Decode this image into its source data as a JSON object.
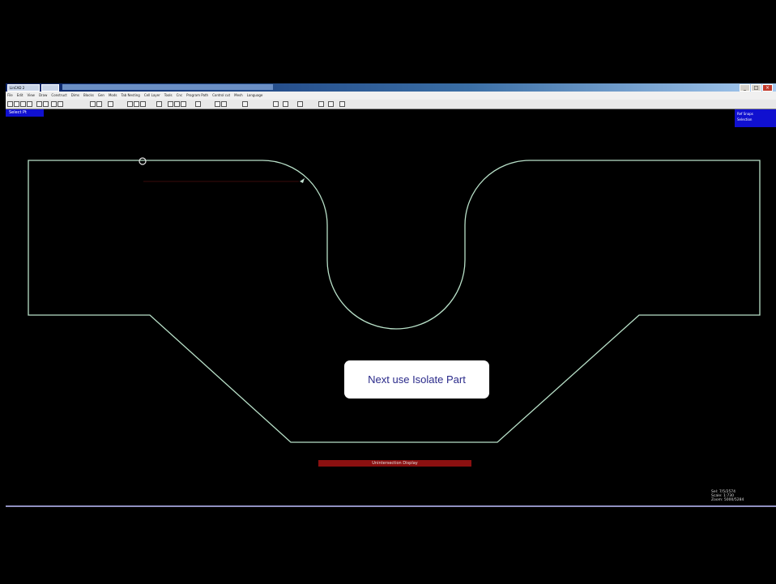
{
  "window": {
    "app_tab": "LinCAD 2",
    "window_controls": [
      "_",
      "□",
      "×"
    ]
  },
  "menu": [
    "File",
    "Edit",
    "View",
    "Draw",
    "Construct",
    "Dims",
    "Blocks",
    "Gen",
    "Mods",
    "Tab Nesting",
    "Cell Layer",
    "Tools",
    "Cnc",
    "Program Path",
    "Control cut",
    "Mesh",
    "Language"
  ],
  "status": {
    "left": "Select Pt",
    "right_line1": "Ref Snaps",
    "right_line2": "Selection"
  },
  "callout": {
    "text": "Next use Isolate Part"
  },
  "banner": {
    "text": "Unintersection Display"
  },
  "readout": {
    "line1": "Sel: 7/5/2574",
    "line2": "Scale: 1:730",
    "line3": "Zoom: 5000/5284"
  },
  "colors": {
    "outline": "#b8e0c8",
    "callout_text": "#2a2a8a",
    "banner": "#8b1010",
    "status": "#1010d0"
  }
}
